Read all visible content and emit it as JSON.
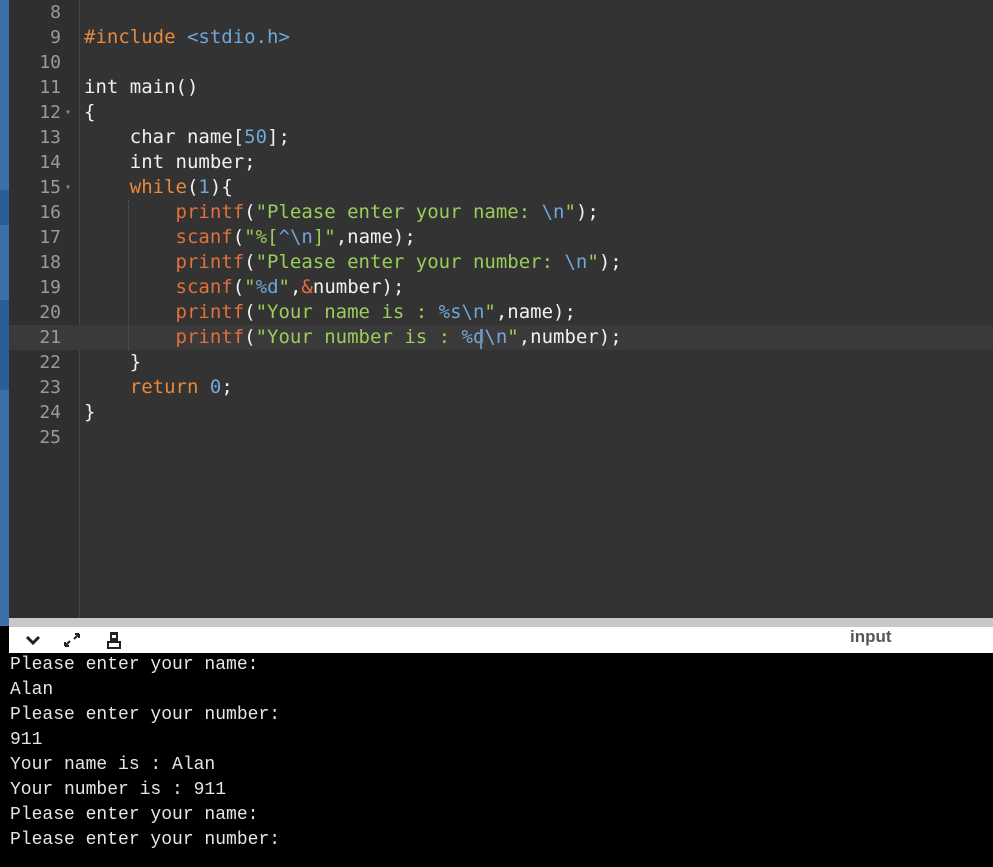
{
  "editor": {
    "lines": [
      {
        "n": "8",
        "t": []
      },
      {
        "n": "9",
        "t": [
          {
            "c": "kw",
            "v": "#include "
          },
          {
            "c": "num",
            "v": "<stdio.h>"
          }
        ]
      },
      {
        "n": "10",
        "t": []
      },
      {
        "n": "11",
        "t": [
          {
            "c": "",
            "v": "int main()"
          }
        ]
      },
      {
        "n": "12",
        "fold": true,
        "t": [
          {
            "c": "",
            "v": "{"
          }
        ]
      },
      {
        "n": "13",
        "t": [
          {
            "c": "",
            "v": "    char name["
          },
          {
            "c": "num",
            "v": "50"
          },
          {
            "c": "",
            "v": "];"
          }
        ]
      },
      {
        "n": "14",
        "t": [
          {
            "c": "",
            "v": "    int number;"
          }
        ]
      },
      {
        "n": "15",
        "fold": true,
        "t": [
          {
            "c": "",
            "v": "    "
          },
          {
            "c": "kw",
            "v": "while"
          },
          {
            "c": "",
            "v": "("
          },
          {
            "c": "num",
            "v": "1"
          },
          {
            "c": "",
            "v": "){"
          }
        ]
      },
      {
        "n": "16",
        "t": [
          {
            "c": "",
            "v": "        "
          },
          {
            "c": "fn",
            "v": "printf"
          },
          {
            "c": "",
            "v": "("
          },
          {
            "c": "str",
            "v": "\"Please enter your name: "
          },
          {
            "c": "esc",
            "v": "\\n"
          },
          {
            "c": "str",
            "v": "\""
          },
          {
            "c": "",
            "v": ");"
          }
        ]
      },
      {
        "n": "17",
        "t": [
          {
            "c": "",
            "v": "        "
          },
          {
            "c": "fn",
            "v": "scanf"
          },
          {
            "c": "",
            "v": "("
          },
          {
            "c": "str",
            "v": "\"%["
          },
          {
            "c": "esc",
            "v": "^\\n"
          },
          {
            "c": "str",
            "v": "]\""
          },
          {
            "c": "",
            "v": ",name);"
          }
        ]
      },
      {
        "n": "18",
        "t": [
          {
            "c": "",
            "v": "        "
          },
          {
            "c": "fn",
            "v": "printf"
          },
          {
            "c": "",
            "v": "("
          },
          {
            "c": "str",
            "v": "\"Please enter your number: "
          },
          {
            "c": "esc",
            "v": "\\n"
          },
          {
            "c": "str",
            "v": "\""
          },
          {
            "c": "",
            "v": ");"
          }
        ]
      },
      {
        "n": "19",
        "t": [
          {
            "c": "",
            "v": "        "
          },
          {
            "c": "fn",
            "v": "scanf"
          },
          {
            "c": "",
            "v": "("
          },
          {
            "c": "str",
            "v": "\""
          },
          {
            "c": "esc",
            "v": "%d"
          },
          {
            "c": "str",
            "v": "\""
          },
          {
            "c": "",
            "v": ","
          },
          {
            "c": "fn",
            "v": "&"
          },
          {
            "c": "",
            "v": "number);"
          }
        ]
      },
      {
        "n": "20",
        "t": [
          {
            "c": "",
            "v": "        "
          },
          {
            "c": "fn",
            "v": "printf"
          },
          {
            "c": "",
            "v": "("
          },
          {
            "c": "str",
            "v": "\"Your name is : "
          },
          {
            "c": "esc",
            "v": "%s\\n"
          },
          {
            "c": "str",
            "v": "\""
          },
          {
            "c": "",
            "v": ",name);"
          }
        ]
      },
      {
        "n": "21",
        "active": true,
        "t": [
          {
            "c": "",
            "v": "        "
          },
          {
            "c": "fn",
            "v": "printf"
          },
          {
            "c": "",
            "v": "("
          },
          {
            "c": "str",
            "v": "\"Your number is : "
          },
          {
            "c": "esc",
            "v": "%d\\n"
          },
          {
            "c": "str",
            "v": "\""
          },
          {
            "c": "",
            "v": ",number);"
          }
        ]
      },
      {
        "n": "22",
        "t": [
          {
            "c": "",
            "v": "    }"
          }
        ]
      },
      {
        "n": "23",
        "t": [
          {
            "c": "",
            "v": "    "
          },
          {
            "c": "kw",
            "v": "return"
          },
          {
            "c": "",
            "v": " "
          },
          {
            "c": "num",
            "v": "0"
          },
          {
            "c": "",
            "v": ";"
          }
        ]
      },
      {
        "n": "24",
        "t": [
          {
            "c": "",
            "v": "}"
          }
        ]
      },
      {
        "n": "25",
        "t": []
      }
    ]
  },
  "toolbar": {
    "collapse_icon": "chevron-down-icon",
    "expand_icon": "expand-arrows-icon",
    "clear_icon": "clear-console-icon",
    "input_tab": "input"
  },
  "console": {
    "lines": [
      "Please enter your name:",
      "Alan",
      "Please enter your number:",
      "911",
      "Your name is : Alan",
      "Your number is : 911",
      "Please enter your name:",
      "Please enter your number:"
    ]
  },
  "colors": {
    "keyword": "#e88a3c",
    "string": "#9acd5a",
    "number": "#6fa7d8",
    "editor_bg": "#333333",
    "console_bg": "#000000"
  }
}
